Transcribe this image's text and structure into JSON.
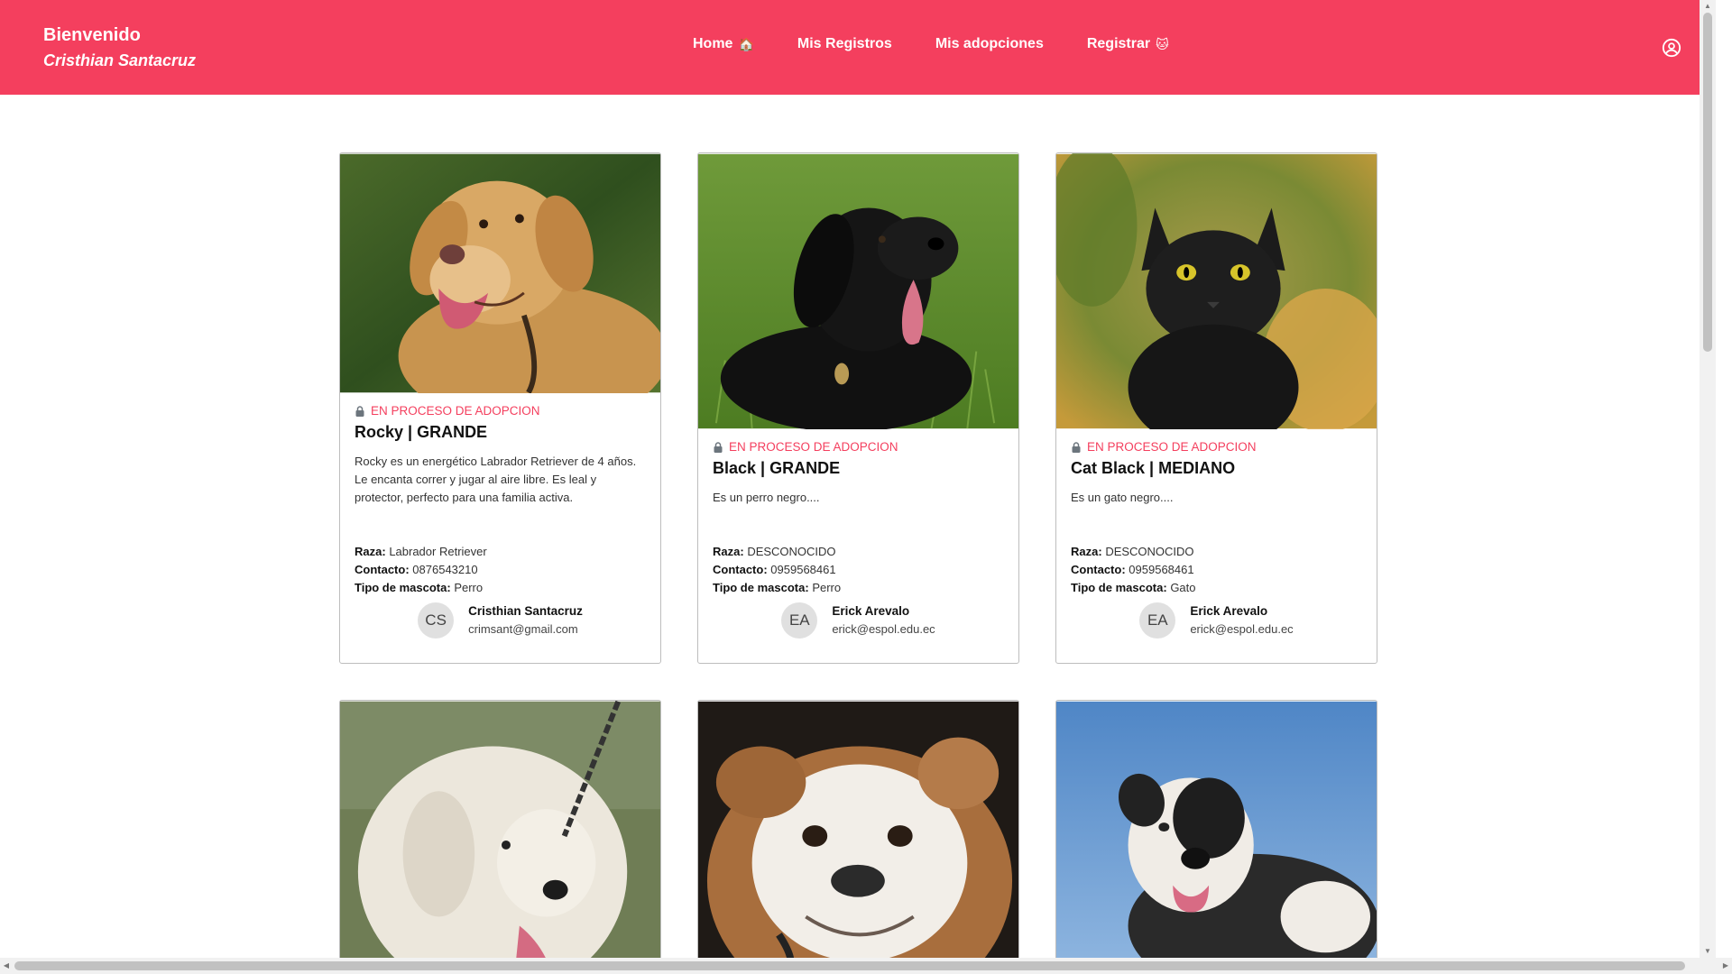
{
  "header": {
    "welcome": "Bienvenido",
    "user_name": "Cristhian Santacruz",
    "nav": [
      {
        "label": "Home",
        "emoji": "🏠"
      },
      {
        "label": "Mis Registros",
        "emoji": ""
      },
      {
        "label": "Mis adopciones",
        "emoji": ""
      },
      {
        "label": "Registrar",
        "emoji": "🐱"
      }
    ],
    "user_icon": "user-circle-icon"
  },
  "colors": {
    "accent": "#f43f5e",
    "border": "#bdbdbd"
  },
  "labels": {
    "raza": "Raza:",
    "contacto": "Contacto:",
    "tipo": "Tipo de mascota:"
  },
  "pets": [
    {
      "status": "EN PROCESO DE ADOPCION",
      "title": "Rocky | GRANDE",
      "description": "Rocky es un energético Labrador Retriever de 4 años. Le encanta correr y jugar al aire libre. Es leal y protector, perfecto para una familia activa.",
      "raza": "Labrador Retriever",
      "contacto": "0876543210",
      "tipo": "Perro",
      "owner_initials": "CS",
      "owner_name": "Cristhian Santacruz",
      "owner_email": "crimsant@gmail.com",
      "image": "golden-labrador-photo"
    },
    {
      "status": "EN PROCESO DE ADOPCION",
      "title": "Black | GRANDE",
      "description": "Es un perro negro....",
      "raza": "DESCONOCIDO",
      "contacto": "0959568461",
      "tipo": "Perro",
      "owner_initials": "EA",
      "owner_name": "Erick Arevalo",
      "owner_email": "erick@espol.edu.ec",
      "image": "black-dog-grass-photo"
    },
    {
      "status": "EN PROCESO DE ADOPCION",
      "title": "Cat Black | MEDIANO",
      "description": "Es un gato negro....",
      "raza": "DESCONOCIDO",
      "contacto": "0959568461",
      "tipo": "Gato",
      "owner_initials": "EA",
      "owner_name": "Erick Arevalo",
      "owner_email": "erick@espol.edu.ec",
      "image": "black-cat-photo"
    }
  ],
  "more_pets": [
    {
      "image": "white-fluffy-dog-photo"
    },
    {
      "image": "bulldog-photo"
    },
    {
      "image": "black-white-pitbull-photo"
    }
  ]
}
